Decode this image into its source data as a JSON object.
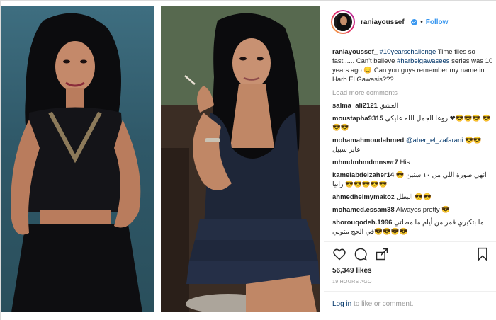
{
  "post": {
    "username": "raniayoussef_",
    "separator": "•",
    "follow_label": "Follow",
    "caption_user": "raniayoussef_",
    "caption_tag1": "#10yearschallenge",
    "caption_text1": " Time flies so fast...... Can't believe ",
    "caption_tag2": "#harbelgawasees",
    "caption_text2": " series was 10 years ago 😊 Can you guys remember my name in Harb El Gawasis???",
    "load_more": "Load more comments",
    "likes": "56,349 likes",
    "time": "19 HOURS AGO",
    "login_link": "Log in",
    "login_rest": " to like or comment."
  },
  "comments": [
    {
      "user": "salma_ali2121",
      "text": "العشق"
    },
    {
      "user": "moustapha9315",
      "text": "روعا الجمل الله عليكي ❤😎😎😎 😎😎😎"
    },
    {
      "user": "mohamahmoudahmed",
      "mention": "@aber_el_zafarani",
      "text": "😎😎 عابر سبيل"
    },
    {
      "user": "mhmdmhmdmnswr7",
      "text": "His"
    },
    {
      "user": "kamelabdelzaher14",
      "text": "انهي صورة اللي من ١٠ سنين 😎😎😎😎😎😎 رانيا"
    },
    {
      "user": "ahmedhelmymakoz",
      "text": "البطل 😎😎"
    },
    {
      "user": "mohamed.essam38",
      "text": "Alwayes pretty 😎"
    },
    {
      "user": "shorouqodeh.1996",
      "text": "ما بتكبري قمر من أيام ما مطلتي 😎😎😎😎في الحج متولي"
    }
  ],
  "icons": {
    "heart": "heart-icon",
    "comment": "comment-icon",
    "share": "share-icon",
    "save": "bookmark-icon"
  },
  "colors": {
    "link": "#3897f0",
    "tag": "#003569",
    "muted": "#999999"
  }
}
